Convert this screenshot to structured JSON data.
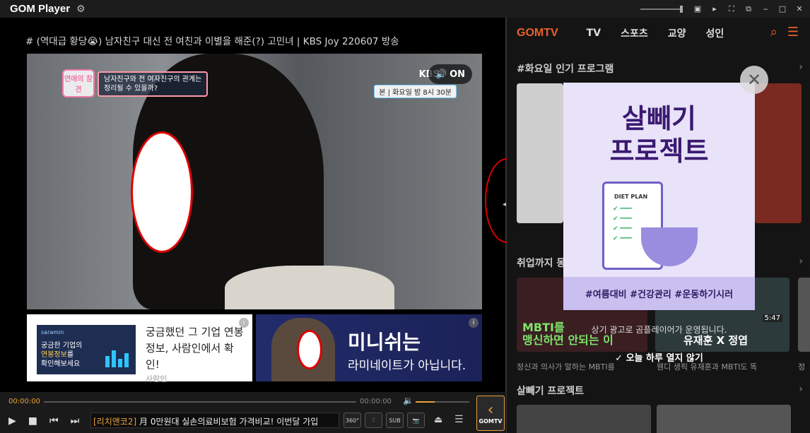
{
  "app": {
    "title": "GOM Player"
  },
  "player": {
    "video_title": "# (역대급 황당😭) 남자친구 대신 전 여친과 이별을 해준(?) 고민녀 | KBS Joy 220607 방송",
    "overlay": {
      "show_logo": "연애의 참견",
      "caption_line1": "남자친구와 전 여자친구의 관계는",
      "caption_line2": "정리될 수 있을까?",
      "channel": "KBS",
      "sound_label": "ON",
      "schedule": "본 | 화요일 밤 8시 30분"
    },
    "ad_left": {
      "brand": "saramin",
      "thumb_line1": "궁금한 기업의",
      "thumb_hl": "연봉정보",
      "thumb_line2": "를",
      "thumb_line3": "확인해보세요",
      "copy": "궁금했던 그 기업 연봉정보, 사람인에서 확인!",
      "sub": "사람인",
      "info": "i"
    },
    "ad_right": {
      "headline": "미니쉬는",
      "sub": "라미네이트가 아닙니다.",
      "info": "i"
    }
  },
  "controls": {
    "time_current": "00:00:00",
    "time_total": "00:00:00",
    "volume_level": 0.35,
    "ticker_tag": "[리치앤코2]",
    "ticker_text": "月 0만원대 실손의료비보험 가격비교! 이번달 가입",
    "btn_360": "360°",
    "btn_sub": "SUB",
    "gomtv_label": "GOMTV"
  },
  "side": {
    "logo": "GOMTV",
    "tabs": [
      "TV",
      "스포츠",
      "교양",
      "성인"
    ],
    "section1": "#화요일 인기 프로그램",
    "section2": "취업까지 몽",
    "section3": "살빼기 프로젝트",
    "card_texts": [
      "정신과 의사가 말하는 MBTI를",
      "웬디 생픽 유재훈과 MBTI도 똑",
      "정"
    ],
    "thumb_texts": [
      "MBTI를",
      "맹신하면 안되는 이",
      "유재훈 X 정엽",
      "5:47"
    ]
  },
  "popup": {
    "title_line1": "살빼기",
    "title_line2": "프로젝트",
    "diet_plan": "DIET PLAN",
    "hashtags": "#여름대비 #건강관리 #운동하기시러",
    "notice": "상기 광고로 곰플레이어가 운영됩니다.",
    "hide_today": "✓  오늘 하루 열지 않기"
  },
  "colors": {
    "accent": "#e8a13a",
    "gomtv": "#e8612c"
  }
}
